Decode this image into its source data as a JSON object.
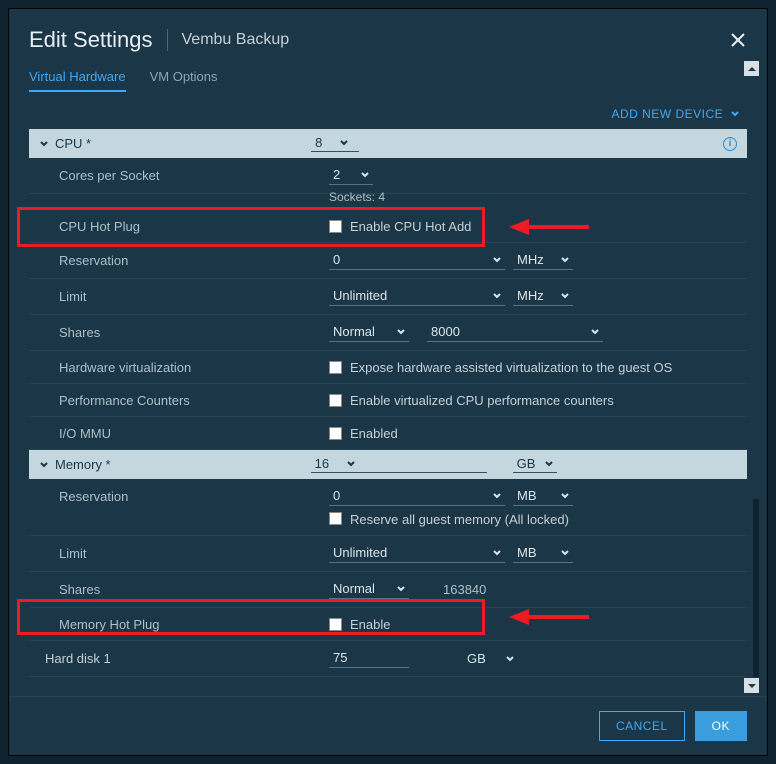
{
  "dialog": {
    "title": "Edit Settings",
    "subtitle": "Vembu Backup",
    "tabs": [
      "Virtual Hardware",
      "VM Options"
    ],
    "active_tab": 0,
    "add_device": "ADD NEW DEVICE"
  },
  "cpu": {
    "header": "CPU *",
    "value": "8",
    "cores_per_socket_label": "Cores per Socket",
    "cores_per_socket_value": "2",
    "sockets_text": "Sockets: 4",
    "hot_plug_label": "CPU Hot Plug",
    "hot_plug_checkbox": "Enable CPU Hot Add",
    "reservation_label": "Reservation",
    "reservation_value": "0",
    "reservation_unit": "MHz",
    "limit_label": "Limit",
    "limit_value": "Unlimited",
    "limit_unit": "MHz",
    "shares_label": "Shares",
    "shares_value": "Normal",
    "shares_num": "8000",
    "hw_virt_label": "Hardware virtualization",
    "hw_virt_checkbox": "Expose hardware assisted virtualization to the guest OS",
    "perf_counters_label": "Performance Counters",
    "perf_counters_checkbox": "Enable virtualized CPU performance counters",
    "iommu_label": "I/O MMU",
    "iommu_checkbox": "Enabled"
  },
  "memory": {
    "header": "Memory *",
    "value": "16",
    "unit": "GB",
    "reservation_label": "Reservation",
    "reservation_value": "0",
    "reservation_unit": "MB",
    "reserve_all_label": "Reserve all guest memory (All locked)",
    "limit_label": "Limit",
    "limit_value": "Unlimited",
    "limit_unit": "MB",
    "shares_label": "Shares",
    "shares_value": "Normal",
    "shares_num": "163840",
    "hot_plug_label": "Memory Hot Plug",
    "hot_plug_checkbox": "Enable"
  },
  "hard_disk": {
    "header": "Hard disk 1",
    "value": "75",
    "unit": "GB"
  },
  "footer": {
    "cancel": "CANCEL",
    "ok": "OK"
  }
}
